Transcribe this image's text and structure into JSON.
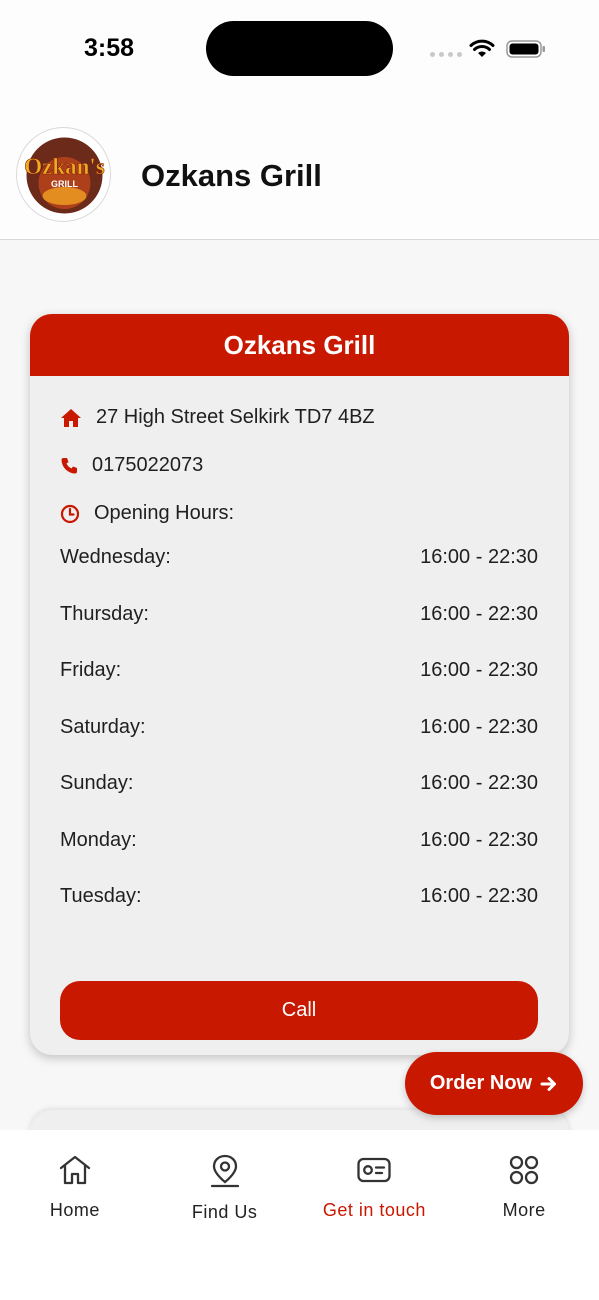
{
  "status_bar": {
    "time": "3:58"
  },
  "header": {
    "logo_text": "Ozkan's",
    "logo_subtext": "GRILL",
    "title": "Ozkans Grill"
  },
  "card": {
    "title": "Ozkans Grill",
    "address": "27 High Street Selkirk TD7 4BZ",
    "phone": "0175022073",
    "opening_hours_label": "Opening Hours:",
    "hours": [
      {
        "day": "Wednesday:",
        "time": "16:00 - 22:30"
      },
      {
        "day": "Thursday:",
        "time": "16:00 - 22:30"
      },
      {
        "day": "Friday:",
        "time": "16:00 - 22:30"
      },
      {
        "day": "Saturday:",
        "time": "16:00 - 22:30"
      },
      {
        "day": "Sunday:",
        "time": "16:00 - 22:30"
      },
      {
        "day": "Monday:",
        "time": "16:00 - 22:30"
      },
      {
        "day": "Tuesday:",
        "time": "16:00 - 22:30"
      }
    ],
    "call_label": "Call"
  },
  "order_button": {
    "label": "Order Now",
    "icon": "arrow-right-icon"
  },
  "tab_bar": {
    "tabs": [
      {
        "label": "Home",
        "icon": "home-icon"
      },
      {
        "label": "Find Us",
        "icon": "location-pin-icon"
      },
      {
        "label": "Get in touch",
        "icon": "contact-card-icon",
        "active": true
      },
      {
        "label": "More",
        "icon": "grid-icon"
      }
    ]
  },
  "colors": {
    "accent": "#c81800",
    "card_bg": "#efefef",
    "page_bg": "#f7f7f7"
  }
}
